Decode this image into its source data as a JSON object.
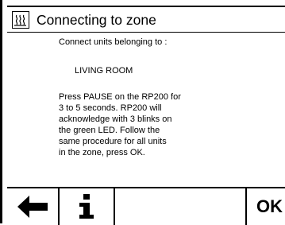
{
  "dialog": {
    "title": "Connecting to zone",
    "title_icon": "heating-zone-icon",
    "intro": "Connect units belonging to :",
    "zone_name": "LIVING ROOM",
    "instructions": [
      "Press PAUSE on the RP200 for",
      "3 to 5 seconds. RP200 will",
      "acknowledge with 3 blinks on",
      "the green LED. Follow the",
      "same procedure for all units",
      "in the zone, press OK."
    ]
  },
  "buttons": {
    "back_icon": "arrow-left-icon",
    "info_icon": "info-icon",
    "ok_label": "OK"
  }
}
